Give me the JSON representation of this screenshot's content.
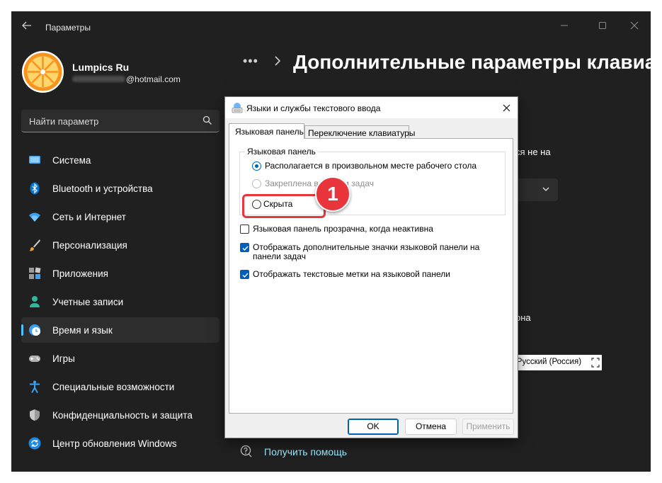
{
  "window": {
    "title": "Параметры"
  },
  "profile": {
    "name": "Lumpics Ru",
    "email_suffix": "@hotmail.com"
  },
  "search": {
    "placeholder": "Найти параметр"
  },
  "sidebar": {
    "items": [
      {
        "label": "Система",
        "icon": "system-icon",
        "active": false
      },
      {
        "label": "Bluetooth и устройства",
        "icon": "bluetooth-icon",
        "active": false
      },
      {
        "label": "Сеть и Интернет",
        "icon": "wifi-icon",
        "active": false
      },
      {
        "label": "Персонализация",
        "icon": "brush-icon",
        "active": false
      },
      {
        "label": "Приложения",
        "icon": "apps-icon",
        "active": false
      },
      {
        "label": "Учетные записи",
        "icon": "person-icon",
        "active": false
      },
      {
        "label": "Время и язык",
        "icon": "time-language-icon",
        "active": true
      },
      {
        "label": "Игры",
        "icon": "gamepad-icon",
        "active": false
      },
      {
        "label": "Специальные возможности",
        "icon": "accessibility-icon",
        "active": false
      },
      {
        "label": "Конфиденциальность и защита",
        "icon": "shield-icon",
        "active": false
      },
      {
        "label": "Центр обновления Windows",
        "icon": "update-icon",
        "active": false
      }
    ]
  },
  "main": {
    "breadcrumb_dots": "•••",
    "page_title": "Дополнительные параметры клавиа",
    "partial_text_1": "ся не на",
    "partial_text_2": "она",
    "language_bar_text": "RU Русский (Россия)",
    "help_link": "Получить помощь"
  },
  "dialog": {
    "title": "Языки и службы текстового ввода",
    "tabs": [
      {
        "label": "Языковая панель",
        "selected": true
      },
      {
        "label": "Переключение клавиатуры",
        "selected": false
      }
    ],
    "group_label": "Языковая панель",
    "radio_options": [
      {
        "label": "Располагается в произвольном месте рабочего стола",
        "checked": true,
        "disabled": false
      },
      {
        "label": "Закреплена в панели задач",
        "checked": false,
        "disabled": true
      },
      {
        "label": "Скрыта",
        "checked": false,
        "disabled": false
      }
    ],
    "checkboxes": [
      {
        "label": "Языковая панель прозрачна, когда неактивна",
        "checked": false
      },
      {
        "label_line1": "Отображать дополнительные значки языковой панели на",
        "label_line2": "панели задач",
        "checked": true
      },
      {
        "label": "Отображать текстовые метки на языковой панели",
        "checked": true
      }
    ],
    "buttons": {
      "ok": "OK",
      "cancel": "Отмена",
      "apply": "Применить"
    }
  },
  "annotation": {
    "step_number": "1",
    "color": "#e8363c"
  },
  "colors": {
    "accent": "#4cc2ff",
    "window_bg": "#202020",
    "dialog_accent": "#005fb8",
    "link": "#99ebff"
  }
}
